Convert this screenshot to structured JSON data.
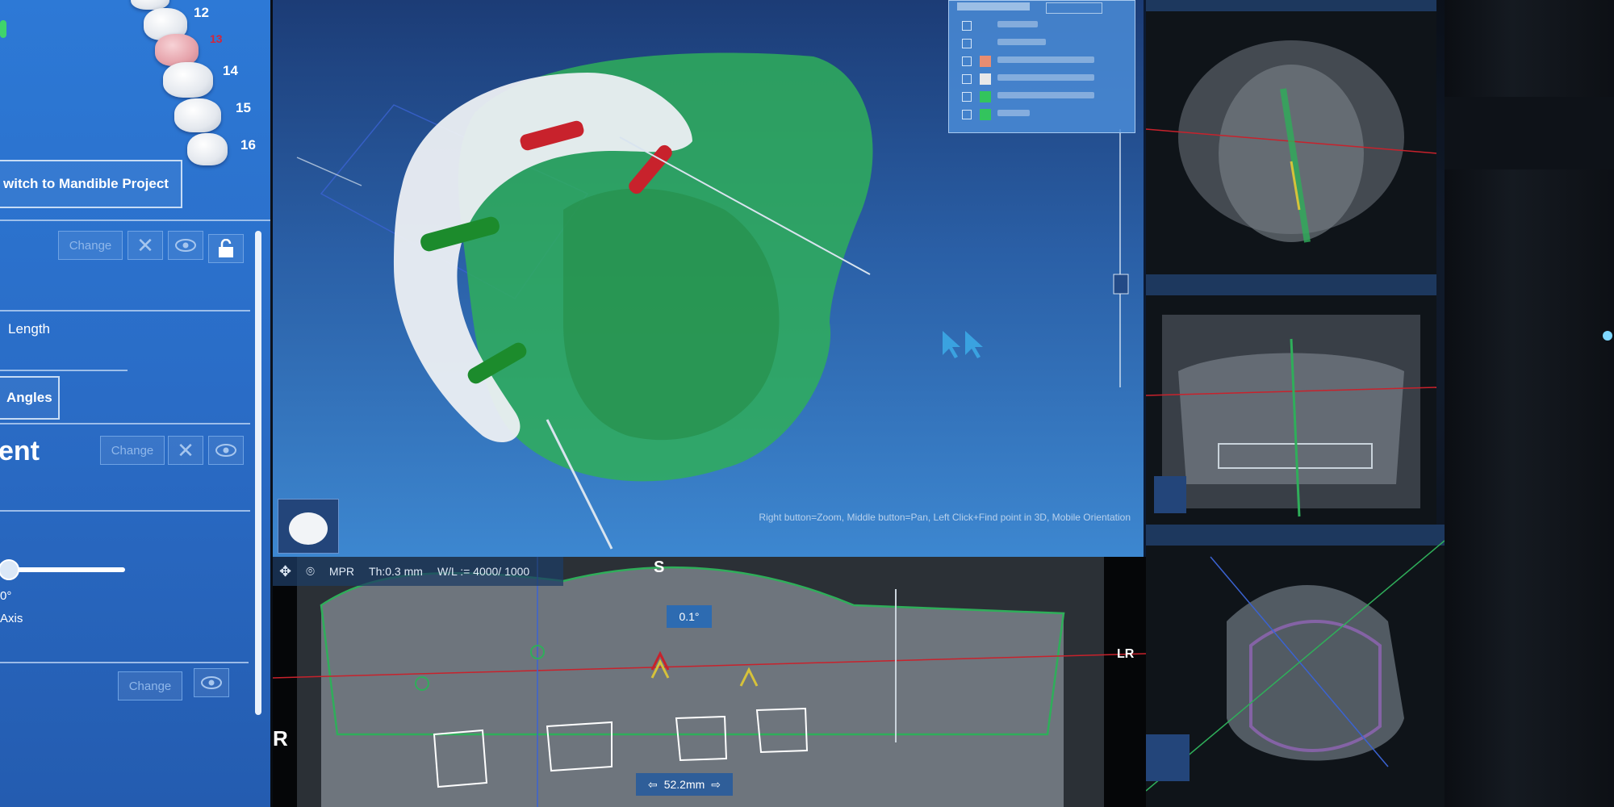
{
  "left_panel": {
    "teeth": [
      {
        "number": "12",
        "highlight": false
      },
      {
        "number": "13",
        "highlight": true
      },
      {
        "number": "14",
        "highlight": false
      },
      {
        "number": "15",
        "highlight": false
      },
      {
        "number": "16",
        "highlight": false
      }
    ],
    "switch_button": "witch to Mandible Project",
    "section1": {
      "change_label": "Change",
      "close_icon": "close-icon",
      "eye_icon": "eye-icon",
      "lock_icon": "lock-icon"
    },
    "length_label": "Length",
    "angles_button": "Angles",
    "section2_title": "ent",
    "section2": {
      "change_label": "Change"
    },
    "slider_value": "0°",
    "axis_label": "Axis",
    "section3": {
      "change_label": "Change"
    }
  },
  "view3d": {
    "status_hint": "Right button=Zoom, Middle button=Pan, Left Click+Find point in 3D, Mobile Orientation"
  },
  "pano": {
    "mode_label": "MPR",
    "thickness_label": "Th:0.3 mm",
    "window_level_label": "W/L := 4000/ 1000",
    "superior_label": "S",
    "right_label": "R",
    "lr_label": "LR",
    "angle_value": "0.1°",
    "distance_value": "52.2mm"
  },
  "colors": {
    "panel_blue": "#2d79d6",
    "model_green": "#2fae5a",
    "implant_red": "#c8222c",
    "implant_green": "#1c8b2c",
    "guide_line": "#d9e4ef"
  }
}
